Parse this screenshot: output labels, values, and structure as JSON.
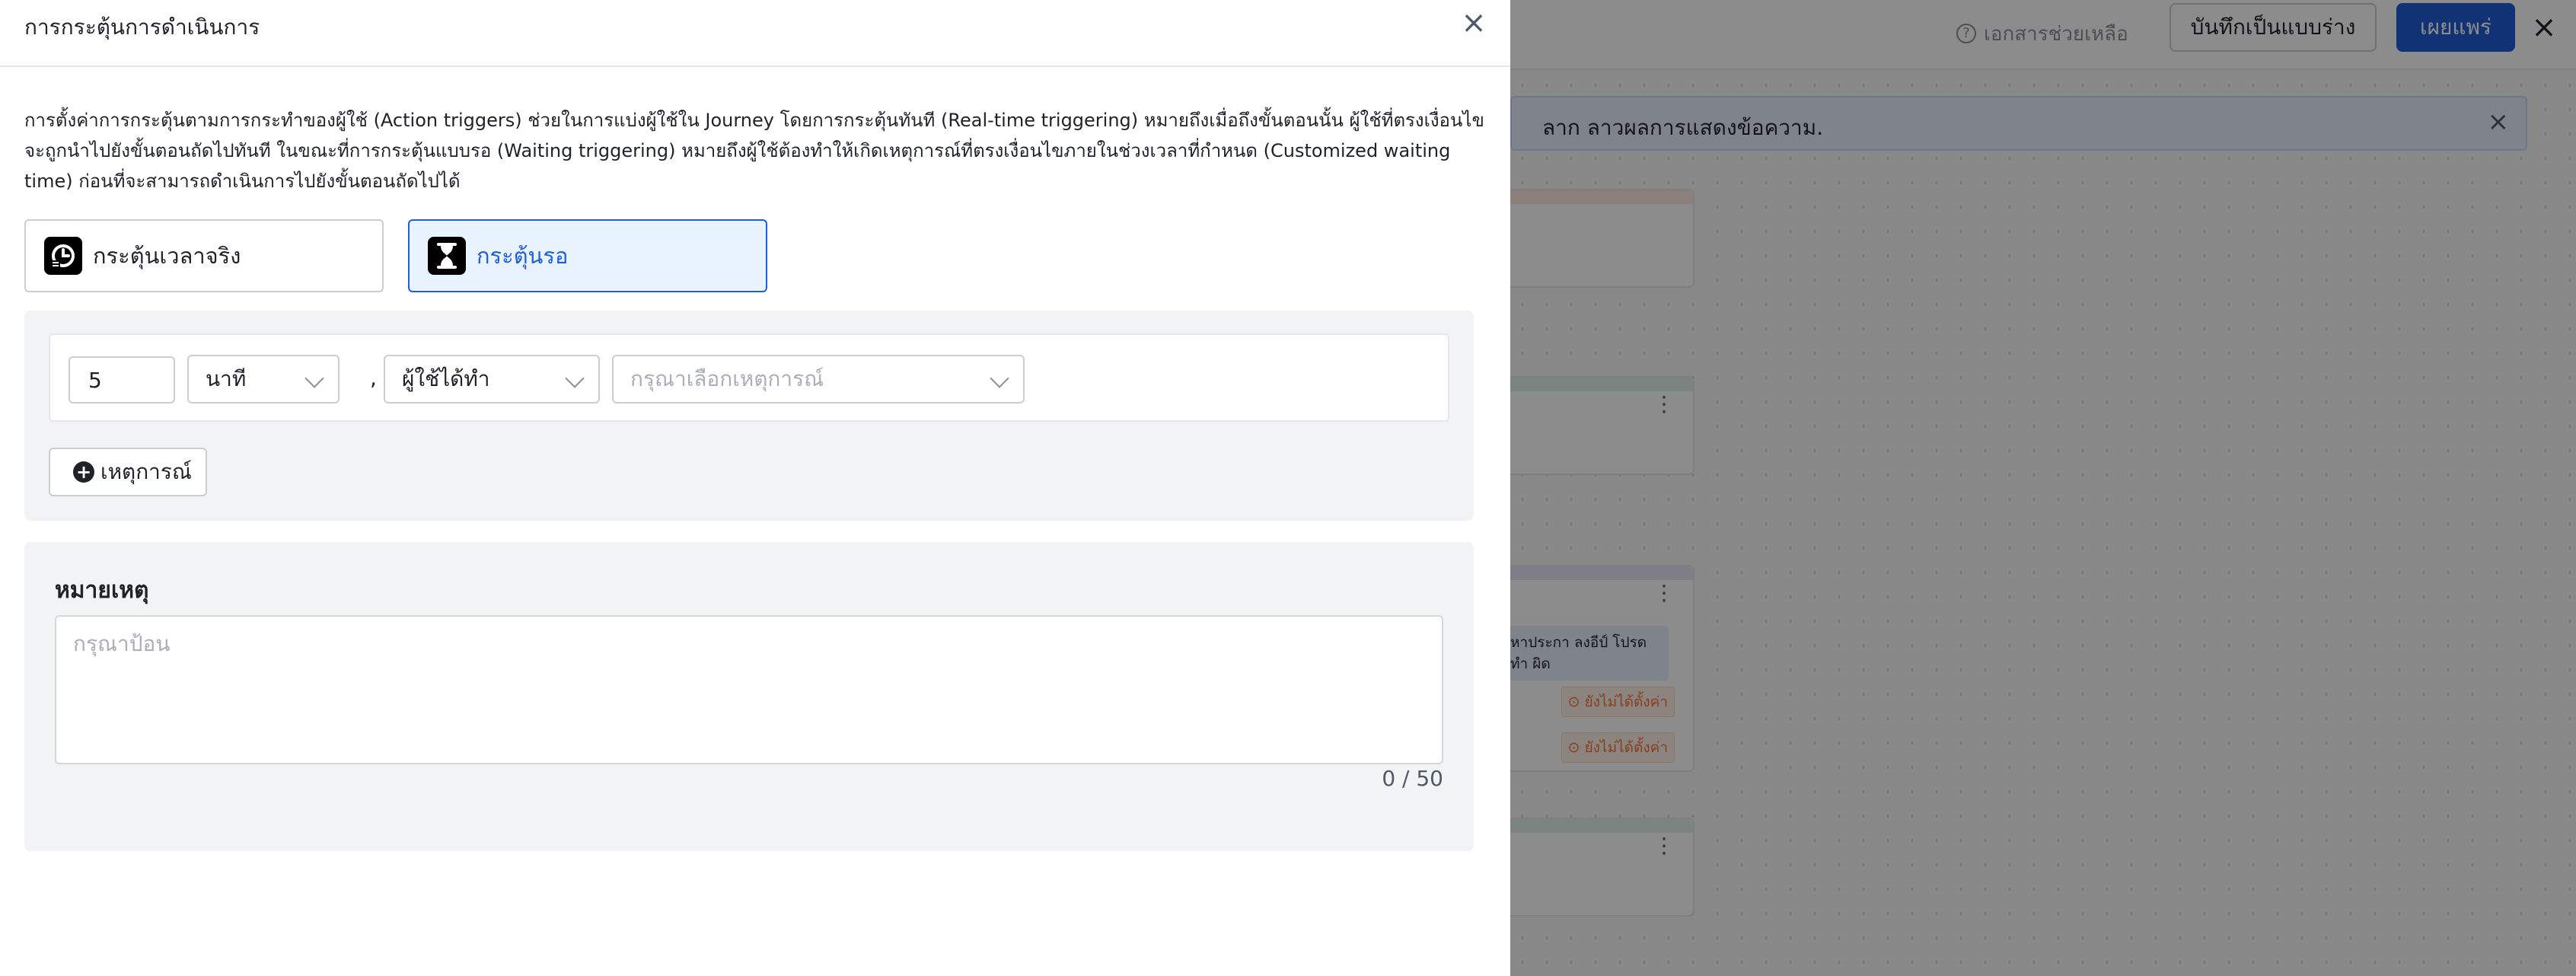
{
  "background": {
    "help_text": "เอกสารช่วยเหลือ",
    "help_icon": "?",
    "draft_button": "บันทึกเป็นแบบร่าง",
    "publish_button": "เผยแพร่",
    "close_icon": "×",
    "banner_text": "ลาก ลาวผลการแสดงข้อความ.",
    "banner_close": "×",
    "card_menu": "⋮",
    "card_text": "หาประกา ลงอีป์ โปรดทำ ผิด",
    "tag_unset": "⊙ ยังไม่ได้ตั้งค่า"
  },
  "drawer": {
    "title": "การกระตุ้นการดำเนินการ",
    "close_icon": "×",
    "description": "การตั้งค่าการกระตุ้นตามการกระทำของผู้ใช้ (Action triggers) ช่วยในการแบ่งผู้ใช้ใน Journey โดยการกระตุ้นทันที (Real-time triggering) หมายถึงเมื่อถึงขั้นตอนนั้น ผู้ใช้ที่ตรงเงื่อนไขจะถูกนำไปยังขั้นตอนถัดไปทันที ในขณะที่การกระตุ้นแบบรอ (Waiting triggering) หมายถึงผู้ใช้ต้องทำให้เกิดเหตุการณ์ที่ตรงเงื่อนไขภายในช่วงเวลาที่กำหนด (Customized waiting time) ก่อนที่จะสามารถดำเนินการไปยังขั้นตอนถัดไปได้",
    "trigger_options": [
      {
        "label": "กระตุ้นเวลาจริง",
        "icon": "realtime-clock-icon",
        "active": false
      },
      {
        "label": "กระตุ้นรอ",
        "icon": "hourglass-icon",
        "active": true
      }
    ],
    "condition": {
      "wait_value": "5",
      "unit": "นาที",
      "separator": ",",
      "actor": "ผู้ใช้ได้ทำ",
      "event_placeholder": "กรุณาเลือกเหตุการณ์"
    },
    "add_event_button": "เหตุการณ์",
    "note": {
      "title": "หมายเหตุ",
      "placeholder": "กรุณาป้อน",
      "value": "",
      "counter": "0 / 50"
    }
  },
  "colors": {
    "accent": "#1f5ed8",
    "active_bg": "#e8f3ff",
    "panel_bg": "#f2f3f5"
  }
}
